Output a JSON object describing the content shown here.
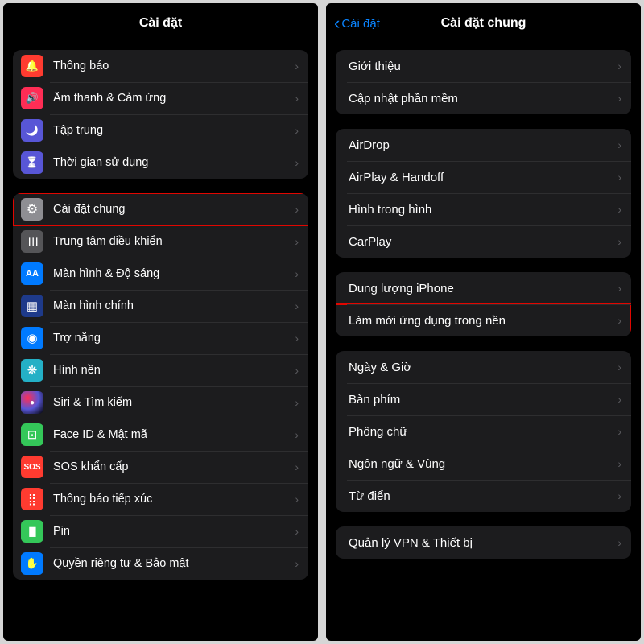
{
  "left": {
    "header": {
      "title": "Cài đặt"
    },
    "groups": [
      {
        "items": [
          {
            "icon": "bell-icon",
            "iconClass": "ic-red bell",
            "label": "Thông báo"
          },
          {
            "icon": "sound-icon",
            "iconClass": "ic-pink sound",
            "label": "Âm thanh & Cảm ứng"
          },
          {
            "icon": "moon-icon",
            "iconClass": "ic-indigo moon",
            "label": "Tập trung"
          },
          {
            "icon": "hourglass-icon",
            "iconClass": "ic-indigo hourglass",
            "label": "Thời gian sử dụng"
          }
        ]
      },
      {
        "items": [
          {
            "icon": "gear-icon",
            "iconClass": "ic-gray gear",
            "label": "Cài đặt chung",
            "highlight": true
          },
          {
            "icon": "control-icon",
            "iconClass": "ic-dgray sliders",
            "label": "Trung tâm điều khiển"
          },
          {
            "icon": "display-icon",
            "iconClass": "ic-blue aa",
            "label": "Màn hình & Độ sáng"
          },
          {
            "icon": "home-icon",
            "iconClass": "ic-navy grid",
            "label": "Màn hình chính"
          },
          {
            "icon": "accessibility-icon",
            "iconClass": "ic-blue access",
            "label": "Trợ năng"
          },
          {
            "icon": "wallpaper-icon",
            "iconClass": "ic-atom atom",
            "label": "Hình nền"
          },
          {
            "icon": "siri-icon",
            "iconClass": "ic-black siri",
            "label": "Siri & Tìm kiếm"
          },
          {
            "icon": "faceid-icon",
            "iconClass": "ic-green face",
            "label": "Face ID & Mật mã"
          },
          {
            "icon": "sos-icon",
            "iconClass": "ic-sos",
            "label": "SOS khẩn cấp",
            "text": "SOS"
          },
          {
            "icon": "exposure-icon",
            "iconClass": "ic-red expose",
            "label": "Thông báo tiếp xúc"
          },
          {
            "icon": "battery-icon",
            "iconClass": "ic-green battery",
            "label": "Pin"
          },
          {
            "icon": "privacy-icon",
            "iconClass": "ic-blue hand",
            "label": "Quyền riêng tư & Bảo mật"
          }
        ]
      }
    ]
  },
  "right": {
    "header": {
      "back": "Cài đặt",
      "title": "Cài đặt chung"
    },
    "groups": [
      {
        "items": [
          {
            "label": "Giới thiệu"
          },
          {
            "label": "Cập nhật phần mềm"
          }
        ]
      },
      {
        "items": [
          {
            "label": "AirDrop"
          },
          {
            "label": "AirPlay & Handoff"
          },
          {
            "label": "Hình trong hình"
          },
          {
            "label": "CarPlay"
          }
        ]
      },
      {
        "items": [
          {
            "label": "Dung lượng iPhone"
          },
          {
            "label": "Làm mới ứng dụng trong nền",
            "highlight": true
          }
        ]
      },
      {
        "items": [
          {
            "label": "Ngày & Giờ"
          },
          {
            "label": "Bàn phím"
          },
          {
            "label": "Phông chữ"
          },
          {
            "label": "Ngôn ngữ & Vùng"
          },
          {
            "label": "Từ điển"
          }
        ]
      },
      {
        "items": [
          {
            "label": "Quản lý VPN & Thiết bị"
          }
        ]
      }
    ]
  }
}
